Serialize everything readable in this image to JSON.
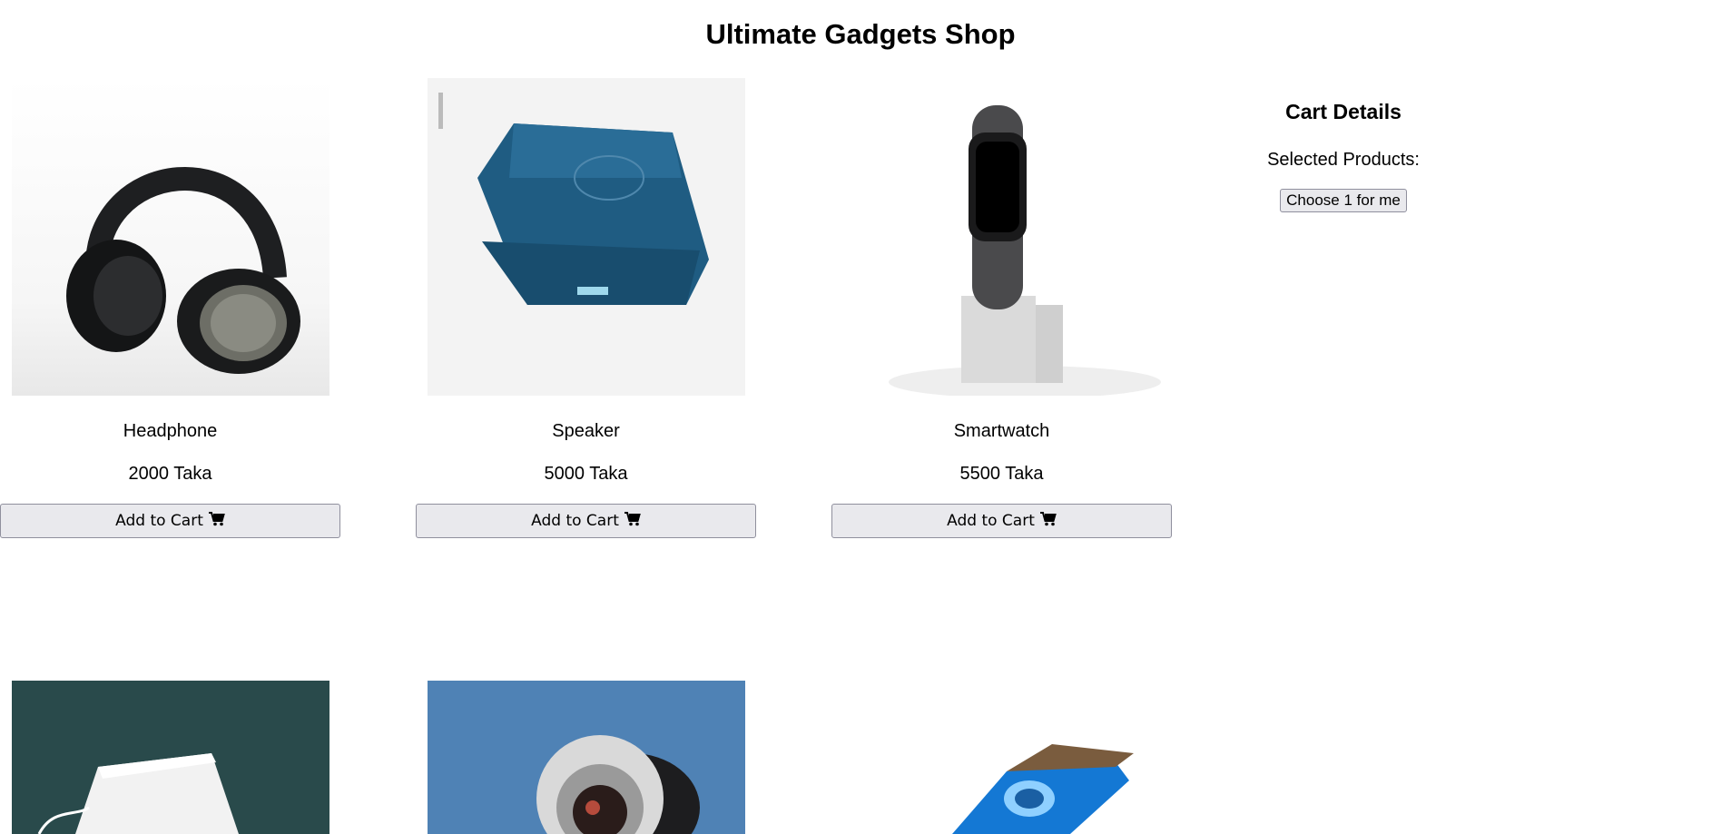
{
  "header": {
    "title": "Ultimate Gadgets Shop"
  },
  "products": [
    {
      "name": "Headphone",
      "price": "2000 Taka",
      "button_label": "Add to Cart",
      "icon": "cart-icon"
    },
    {
      "name": "Speaker",
      "price": "5000 Taka",
      "button_label": "Add to Cart",
      "icon": "cart-icon"
    },
    {
      "name": "Smartwatch",
      "price": "5500 Taka",
      "button_label": "Add to Cart",
      "icon": "cart-icon"
    }
  ],
  "cart": {
    "title": "Cart Details",
    "selected_label": "Selected Products:",
    "choose_button": "Choose 1 for me"
  },
  "colors": {
    "button_bg": "#e9e9ed",
    "button_border": "#8f8f9d",
    "speaker_blue": "#1f5c82"
  }
}
